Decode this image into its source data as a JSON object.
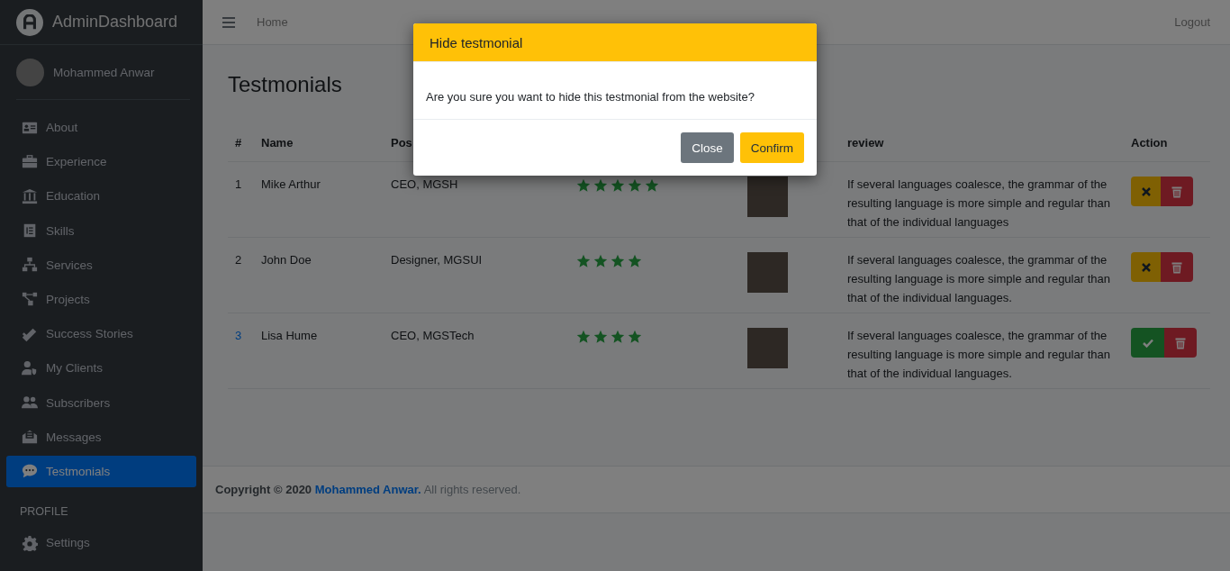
{
  "sidebar": {
    "brand": "AdminDashboard",
    "user": "Mohammed Anwar",
    "items": [
      {
        "label": "About",
        "selected": false
      },
      {
        "label": "Experience",
        "selected": false
      },
      {
        "label": "Education",
        "selected": false
      },
      {
        "label": "Skills",
        "selected": false
      },
      {
        "label": "Services",
        "selected": false
      },
      {
        "label": "Projects",
        "selected": false
      },
      {
        "label": "Success Stories",
        "selected": false
      },
      {
        "label": "My Clients",
        "selected": false
      },
      {
        "label": "Subscribers",
        "selected": false
      },
      {
        "label": "Messages",
        "selected": false
      },
      {
        "label": "Testmonials",
        "selected": true
      }
    ],
    "section": "PROFILE",
    "profile_items": [
      {
        "label": "Settings",
        "selected": false
      }
    ]
  },
  "navbar": {
    "link": "Home",
    "logout": "Logout"
  },
  "page_title": "Testmonials",
  "table": {
    "columns": {
      "number": "#",
      "name": "Name",
      "position": "Pos",
      "review": "review",
      "action": "Action"
    },
    "rows": [
      {
        "number": "1",
        "name": "Mike Arthur",
        "position": "CEO, MGSH",
        "stars": 5,
        "review": "If several languages coalesce, the grammar of the resulting language is more simple and regular than that of the individual languages",
        "visible": true
      },
      {
        "number": "2",
        "name": "John Doe",
        "position": "Designer, MGSUI",
        "stars": 4,
        "review": "If several languages coalesce, the grammar of the resulting language is more simple and regular than that of the individual languages.",
        "visible": true
      },
      {
        "number": "3",
        "name": "Lisa Hume",
        "position": "CEO, MGSTech",
        "stars": 4,
        "review": "If several languages coalesce, the grammar of the resulting language is more simple and regular than that of the individual languages.",
        "visible": false
      }
    ]
  },
  "footer": {
    "link": "Mohammed Anwar.",
    "prefix": "Copyright © 2020",
    "suffix": "All rights reserved."
  },
  "modal": {
    "title": "Hide testmonial",
    "message": "Are you sure you want to hide this testmonial from the website?",
    "buttons": [
      {
        "label": "Close",
        "kind": "secondary"
      },
      {
        "label": "Confirm",
        "kind": "warning"
      }
    ]
  }
}
